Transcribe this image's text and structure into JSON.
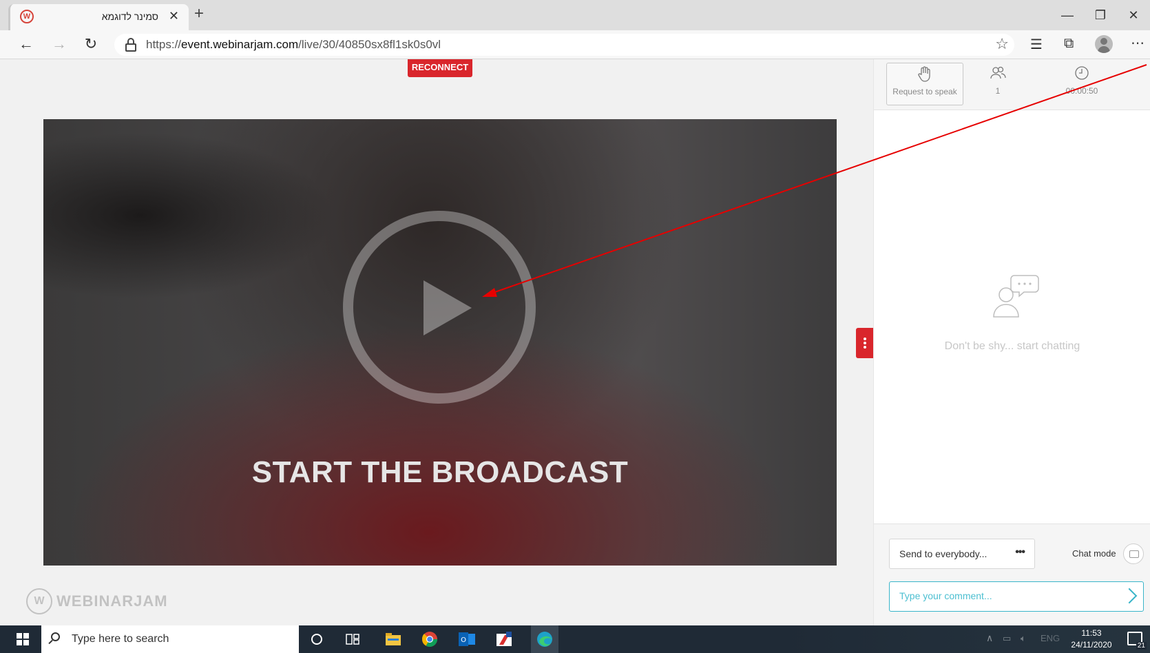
{
  "browser": {
    "tab_title": "סמינר לדוגמא",
    "tab_close": "✕",
    "new_tab": "+",
    "url_prefix": "https://",
    "url_domain": "event.webinarjam.com",
    "url_path": "/live/30/40850sx8fl1sk0s0vl",
    "window_min": "—",
    "window_max": "❐",
    "window_close": "✕"
  },
  "page": {
    "reconnect_label": "RECONNECT",
    "broadcast_label": "START THE BROADCAST",
    "logo_text": "WEBINARJAM"
  },
  "chat": {
    "request_to_speak": "Request to speak",
    "attendees_count": "1",
    "elapsed_time": "00:00:50",
    "empty_message": "Don't be shy... start chatting",
    "send_to": "Send to everybody...",
    "more_dots": "•••",
    "chat_mode": "Chat mode",
    "comment_placeholder": "Type your comment..."
  },
  "taskbar": {
    "search_placeholder": "Type here to search",
    "language": "ENG",
    "time": "11:53",
    "date": "24/11/2020",
    "notification_count": "21"
  },
  "colors": {
    "accent_red": "#d9262c",
    "accent_teal": "#39b5c9",
    "annotation_arrow": "#e60000"
  }
}
